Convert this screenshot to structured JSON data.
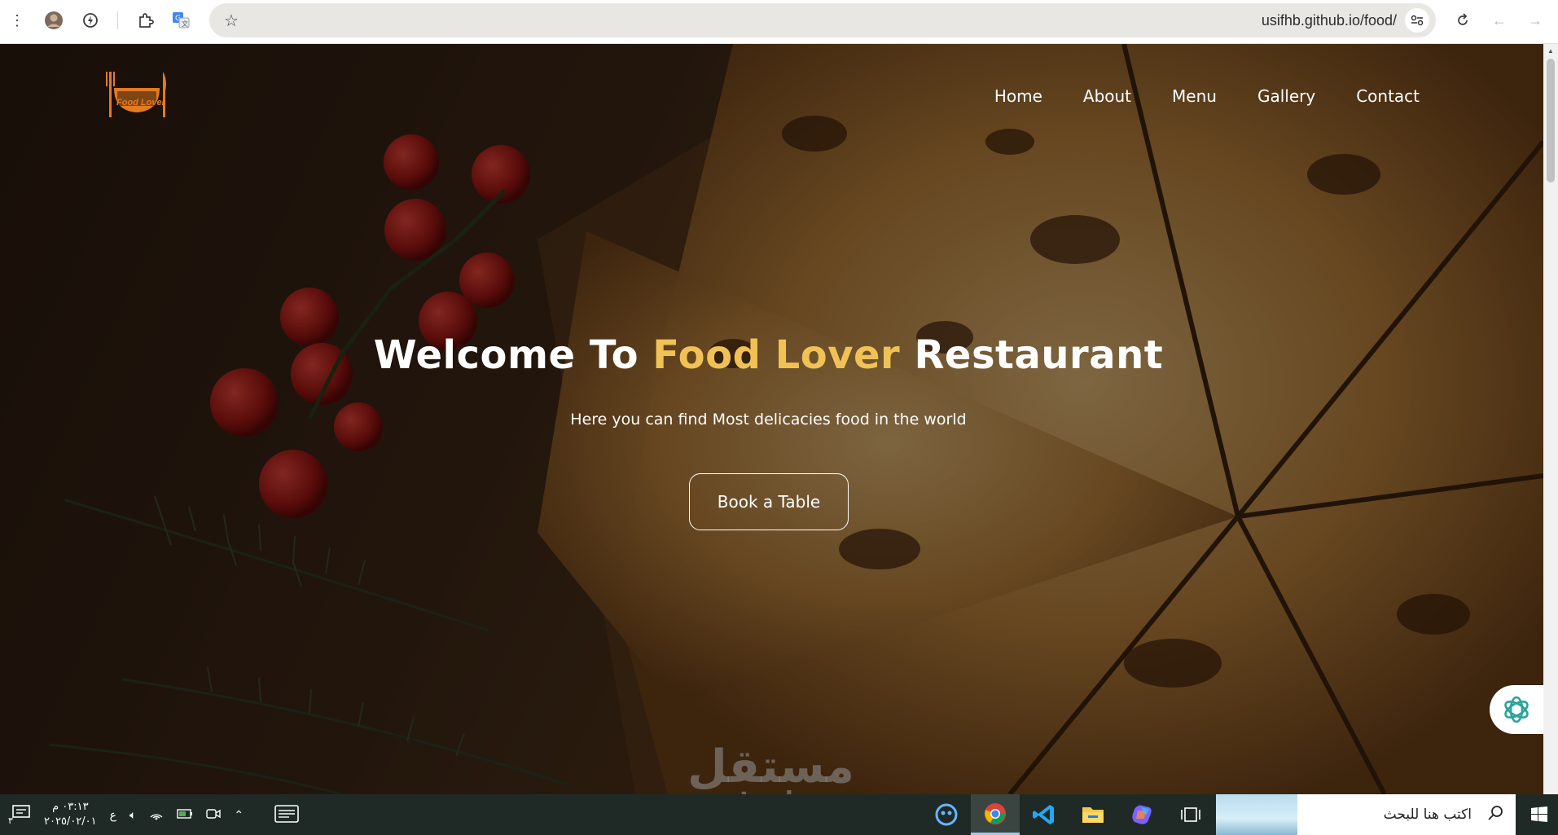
{
  "browser": {
    "url": "usifhb.github.io/food/",
    "toolbar_icons": [
      "menu-dots-icon",
      "profile-avatar-icon",
      "performance-icon",
      "extensions-icon",
      "google-translate-icon",
      "bookmark-star-icon",
      "site-settings-icon",
      "reload-icon",
      "back-icon",
      "forward-icon"
    ]
  },
  "site": {
    "logo_text": "Food Lover",
    "nav": [
      {
        "label": "Home"
      },
      {
        "label": "About"
      },
      {
        "label": "Menu"
      },
      {
        "label": "Gallery"
      },
      {
        "label": "Contact"
      }
    ],
    "hero": {
      "title_prefix": "Welcome To ",
      "title_accent": "Food Lover",
      "title_suffix": " Restaurant",
      "subtitle": "Here you can find Most delicacies food in the world",
      "cta_label": "Book a Table"
    },
    "colors": {
      "accent": "#f0c256",
      "logo": "#e57a1e"
    }
  },
  "watermark": {
    "arabic": "مستقل",
    "latin": "mostaql.com"
  },
  "taskbar": {
    "time": "٠٣:١٣ م",
    "date": "٢٠٢٥/٠٢/٠١",
    "notification_count": "٣",
    "language": "ع",
    "search_placeholder": "اكتب هنا للبحث",
    "apps": [
      "copilot-app-icon",
      "chrome-app-icon",
      "vscode-app-icon",
      "file-explorer-app-icon",
      "copilot-color-app-icon",
      "task-view-icon"
    ]
  }
}
